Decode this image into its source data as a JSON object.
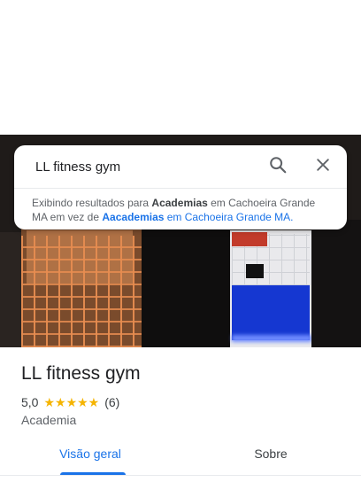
{
  "search": {
    "query": "LL fitness gym",
    "search_icon": "search-icon",
    "close_icon": "close-icon",
    "suggestion": {
      "prefix": "Exibindo resultados para ",
      "corrected_term": "Academias",
      "middle": " em Cachoeira Grande MA em vez de ",
      "original_term": "Aacademias",
      "original_suffix": " em Cachoeira Grande MA."
    }
  },
  "photo": {
    "description_icon": "place-photo"
  },
  "place": {
    "name": "LL fitness gym",
    "rating": "5,0",
    "stars": "★★★★★",
    "review_count": "(6)",
    "category": "Academia"
  },
  "tabs": [
    {
      "label": "Visão geral",
      "active": true
    },
    {
      "label": "Sobre",
      "active": false
    }
  ],
  "colors": {
    "accent": "#1a73e8",
    "star": "#f5b400",
    "text": "#202124"
  }
}
